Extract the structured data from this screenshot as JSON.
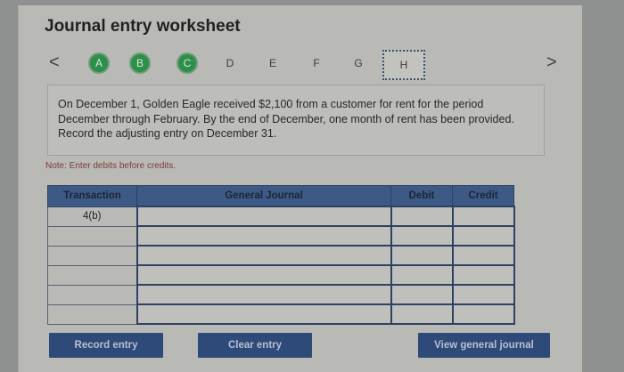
{
  "header": {
    "title": "Journal entry worksheet"
  },
  "steps": {
    "prev_label": "<",
    "next_label": ">",
    "items": [
      {
        "label": "A",
        "state": "done"
      },
      {
        "label": "B",
        "state": "done"
      },
      {
        "label": "C",
        "state": "done"
      },
      {
        "label": "D",
        "state": "pending"
      },
      {
        "label": "E",
        "state": "pending"
      },
      {
        "label": "F",
        "state": "pending"
      },
      {
        "label": "G",
        "state": "pending"
      },
      {
        "label": "H",
        "state": "current"
      }
    ]
  },
  "problem": {
    "text": "On December 1, Golden Eagle received $2,100 from a customer for rent for the period December through February. By the end of December, one month of rent has been provided. Record the adjusting entry on December 31."
  },
  "note": "Note: Enter debits before credits.",
  "journal": {
    "headers": {
      "transaction": "Transaction",
      "general_journal": "General Journal",
      "debit": "Debit",
      "credit": "Credit"
    },
    "rows": [
      {
        "transaction": "4(b)",
        "account": "",
        "debit": "",
        "credit": ""
      },
      {
        "transaction": "",
        "account": "",
        "debit": "",
        "credit": ""
      },
      {
        "transaction": "",
        "account": "",
        "debit": "",
        "credit": ""
      },
      {
        "transaction": "",
        "account": "",
        "debit": "",
        "credit": ""
      },
      {
        "transaction": "",
        "account": "",
        "debit": "",
        "credit": ""
      },
      {
        "transaction": "",
        "account": "",
        "debit": "",
        "credit": ""
      }
    ]
  },
  "buttons": {
    "record": "Record entry",
    "clear": "Clear entry",
    "view": "View general journal"
  },
  "colors": {
    "step_done": "#2d8f4a",
    "header_blue": "#3d5a87",
    "button_blue": "#2e4a78",
    "note_red": "#7d3a37"
  }
}
